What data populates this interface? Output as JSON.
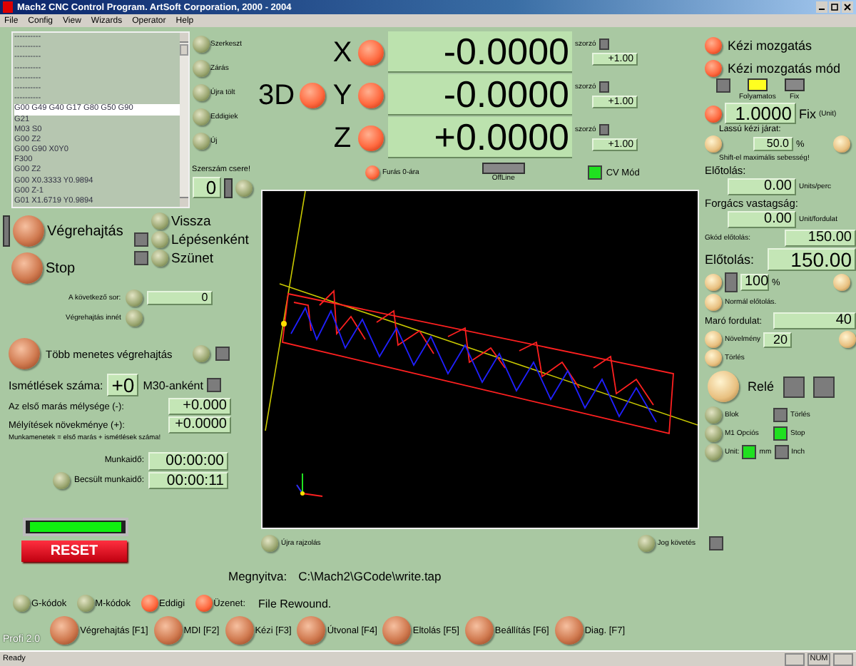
{
  "window": {
    "title": "Mach2 CNC Control Program. ArtSoft Corporation, 2000 - 2004"
  },
  "menu": [
    "File",
    "Config",
    "View",
    "Wizards",
    "Operator",
    "Help"
  ],
  "gcode": {
    "lines": [
      {
        "text": "----------",
        "selected": false
      },
      {
        "text": "----------",
        "selected": false
      },
      {
        "text": "----------",
        "selected": false
      },
      {
        "text": "----------",
        "selected": false
      },
      {
        "text": "----------",
        "selected": false
      },
      {
        "text": "----------",
        "selected": false
      },
      {
        "text": "----------",
        "selected": false
      },
      {
        "text": "G00 G49 G40  G17 G80 G50 G90",
        "selected": true
      },
      {
        "text": "G21",
        "selected": false
      },
      {
        "text": "M03 S0",
        "selected": false
      },
      {
        "text": "G00 Z2",
        "selected": false
      },
      {
        "text": "G00 G90 X0Y0",
        "selected": false
      },
      {
        "text": "F300",
        "selected": false
      },
      {
        "text": "G00 Z2",
        "selected": false
      },
      {
        "text": "G00 X0.3333 Y0.9894",
        "selected": false
      },
      {
        "text": "G00 Z-1",
        "selected": false
      },
      {
        "text": "G01 X1.6719 Y0.9894",
        "selected": false
      }
    ]
  },
  "file_buttons": [
    "Szerkeszt",
    "Zárás",
    "Újra tölt",
    "Eddigiek",
    "Új"
  ],
  "tool_change": {
    "label": "Szerszám csere!",
    "value": "0"
  },
  "dro": {
    "label_3d": "3D",
    "axes": [
      {
        "name": "X",
        "value": "-0.0000",
        "multiplier_label": "szorzó",
        "multiplier": "+1.00"
      },
      {
        "name": "Y",
        "value": "-0.0000",
        "multiplier_label": "szorzó",
        "multiplier": "+1.00"
      },
      {
        "name": "Z",
        "value": "+0.0000",
        "multiplier_label": "szorzó",
        "multiplier": "+1.00"
      }
    ],
    "zero_button": "Furás 0-ára",
    "offline": {
      "label": "OffLine",
      "on": false
    },
    "cv_mode": {
      "label": "CV Mód",
      "on": true
    }
  },
  "run": {
    "cycle_start": "Végrehajtás",
    "stop": "Stop",
    "rewind": "Vissza",
    "single_step": {
      "label": "Lépésenként",
      "on": false
    },
    "pause": {
      "label": "Szünet",
      "on": false
    },
    "next_line": {
      "label": "A következő sor:",
      "value": "0"
    },
    "run_from_here": "Végrehajtás innét"
  },
  "multipass": {
    "button": "Több menetes végrehajtás",
    "on": false,
    "repeat_label": "Ismétlések száma:",
    "repeat": "+0",
    "m30": {
      "label": "M30-anként",
      "on": false
    },
    "first_depth": {
      "label": "Az első marás mélysége (-):",
      "value": "+0.000"
    },
    "increment": {
      "label": "Mélyítések növekménye (+):",
      "value": "+0.0000"
    },
    "note": "Munkamenetek = első marás + ismétlések száma!"
  },
  "times": {
    "runtime": {
      "label": "Munkaidő:",
      "value": "00:00:00"
    },
    "estimate": {
      "label": "Becsült munkaidő:",
      "value": "00:00:11"
    }
  },
  "ready_led": {
    "on": true
  },
  "reset": "RESET",
  "view": {
    "redraw": "Újra rajzolás",
    "jog_follow": {
      "label": "Jog követés",
      "on": false
    }
  },
  "jog": {
    "jog_on_off": "Kézi mozgatás",
    "jog_mode": "Kézi mozgatás mód",
    "indicator": {
      "on": false
    },
    "modes": [
      {
        "label": "Folyamatos",
        "selected": true
      },
      {
        "label": "Fix",
        "selected": false
      }
    ],
    "step": {
      "value": "1.0000",
      "label": "Fix",
      "unit": "(Unit)"
    },
    "slow_jog": {
      "label": "Lassú kézi járat:",
      "value": "50.0",
      "suffix": "%"
    },
    "shift_note": "Shift-el maximális sebesség!"
  },
  "feed": {
    "label": "Előtolás:",
    "value": "0.00",
    "unit": "Units/perc"
  },
  "chip": {
    "label": "Forgács vastagság:",
    "value": "0.00",
    "unit": "Unit/fordulat"
  },
  "program_feed": {
    "label": "Gkód előtolás:",
    "value": "150.00"
  },
  "feedrate": {
    "label": "Előtolás:",
    "value": "150.00"
  },
  "fro": {
    "value": "100",
    "suffix": "%",
    "on": false
  },
  "normal_feed": "Normál előtolás.",
  "spindle": {
    "label": "Maró fordulat:",
    "value": "40"
  },
  "spindle_increment": {
    "label": "Növelmény",
    "value": "20"
  },
  "spindle_reset": "Törlés",
  "relay": {
    "label": "Relé",
    "outputs": [
      {
        "on": false
      },
      {
        "on": false
      }
    ]
  },
  "options": [
    {
      "button": "Blok",
      "indicator": "Törlés",
      "on": false
    },
    {
      "button": "M1 Opciós",
      "indicator": "Stop",
      "on": true
    }
  ],
  "units": {
    "button": "Unit:",
    "options": [
      {
        "label": "mm",
        "selected": true
      },
      {
        "label": "Inch",
        "selected": false
      }
    ]
  },
  "file": {
    "label": "Megnyitva:",
    "path": "C:\\Mach2\\GCode\\write.tap"
  },
  "messages": {
    "items": [
      {
        "label": "G-kódok",
        "kind": "olive"
      },
      {
        "label": "M-kódok",
        "kind": "olive"
      },
      {
        "label": "Eddigi",
        "kind": "red"
      },
      {
        "label": "Üzenet:",
        "kind": "red"
      }
    ],
    "text": "File Rewound."
  },
  "brand": "Profi 2.0",
  "pages": [
    "Végrehajtás [F1]",
    "MDI [F2]",
    "Kézi [F3]",
    "Útvonal [F4]",
    "Eltolás [F5]",
    "Beállítás [F6]",
    "Diag. [F7]"
  ],
  "status_bar": {
    "text": "Ready",
    "indicator": "NUM"
  }
}
